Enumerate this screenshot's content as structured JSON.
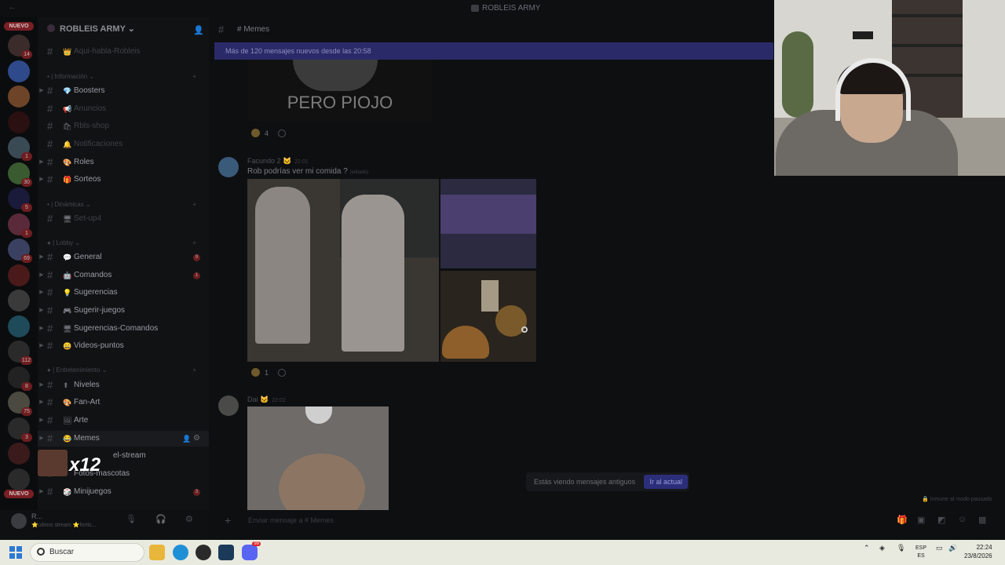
{
  "window": {
    "back_icon": "arrow-left-icon",
    "title": "ROBLEIS ARMY"
  },
  "server_rail": {
    "nuevo_top": "NUEVO",
    "nuevo_bottom": "NUEVO",
    "servers": [
      {
        "color": "#3b2b2b",
        "badge": "14"
      },
      {
        "color": "#2f4a8a",
        "badge": ""
      },
      {
        "color": "#6e4428",
        "badge": ""
      },
      {
        "color": "#2a1010",
        "badge": ""
      },
      {
        "color": "#3a4a55",
        "badge": "1"
      },
      {
        "color": "#3a5a30",
        "badge": "30"
      },
      {
        "color": "#1a1a3a",
        "badge": "5"
      },
      {
        "color": "#5a2a3a",
        "badge": "1"
      },
      {
        "color": "#3a4060",
        "badge": "69"
      },
      {
        "color": "#4a1a1a",
        "badge": ""
      },
      {
        "color": "#3a3a3a",
        "badge": ""
      },
      {
        "color": "#1e4a5a",
        "badge": ""
      },
      {
        "color": "#2a2a2a",
        "badge": "112"
      },
      {
        "color": "#222222",
        "badge": "8"
      },
      {
        "color": "#4a4a40",
        "badge": "75"
      },
      {
        "color": "#2a2a2a",
        "badge": "3"
      },
      {
        "color": "#3a1a1a",
        "badge": ""
      },
      {
        "color": "#2a2a2a",
        "badge": ""
      }
    ]
  },
  "channels": {
    "server_name": "ROBLEIS ARMY",
    "top_channel": "Aqui-habla-Robleis",
    "categories": {
      "informacion": "Información",
      "dinamicas": "Dinámicas",
      "lobby": "Lobby",
      "entretenimiento": "Entretenimiento"
    },
    "items": {
      "boosters": "Boosters",
      "anuncios": "Anuncios",
      "rbls_shop": "Rbls-shop",
      "notificaciones": "Notificaciones",
      "roles": "Roles",
      "sorteos": "Sorteos",
      "setup": "Set-up4",
      "general": "General",
      "comandos": "Comandos",
      "sugerencias": "Sugerencias",
      "sugerir_juegos": "Sugerir-juegos",
      "sugerencias_comandos": "Sugerencias-Comandos",
      "videos_puntos": "Videos-puntos",
      "niveles": "Niveles",
      "fan_art": "Fan-Art",
      "arte": "Arte",
      "memes": "Memes",
      "el_stream": "el-stream",
      "fotos_mascotas": "Fotos-mascotas",
      "minijuegos": "Minijuegos"
    },
    "counts": {
      "general": "9",
      "comandos": "1",
      "minijuegos": "3"
    }
  },
  "overlay": {
    "multiplier": "x12"
  },
  "user_panel": {
    "name": "R...",
    "status": "⭐ultimo stream ⭐fortis..."
  },
  "main": {
    "channel_title": "# Memes",
    "new_messages_banner": "Más de 120 mensajes nuevos desde las 20:58",
    "meme_text": "PERO PIOJO",
    "messages": [
      {
        "author": "",
        "reaction_count": "4"
      },
      {
        "author": "Facundo 2",
        "time": "22:01",
        "text": "Rob podrías ver mi comida ?",
        "edited": "(editado)",
        "reaction_count": "1"
      },
      {
        "author": "Dai",
        "time": "22:02"
      }
    ],
    "old_messages_notice": "Estás viendo mensajes antiguos",
    "jump_button": "Ir al actual",
    "immune_notice": "Inmune al modo pausado",
    "composer_placeholder": "Enviar mensaje a # Memes"
  },
  "taskbar": {
    "search_placeholder": "Buscar",
    "lang_top": "ESP",
    "lang_bottom": "ES",
    "time": "22:24",
    "date": "23/8/2026",
    "discord_badge": "99"
  }
}
